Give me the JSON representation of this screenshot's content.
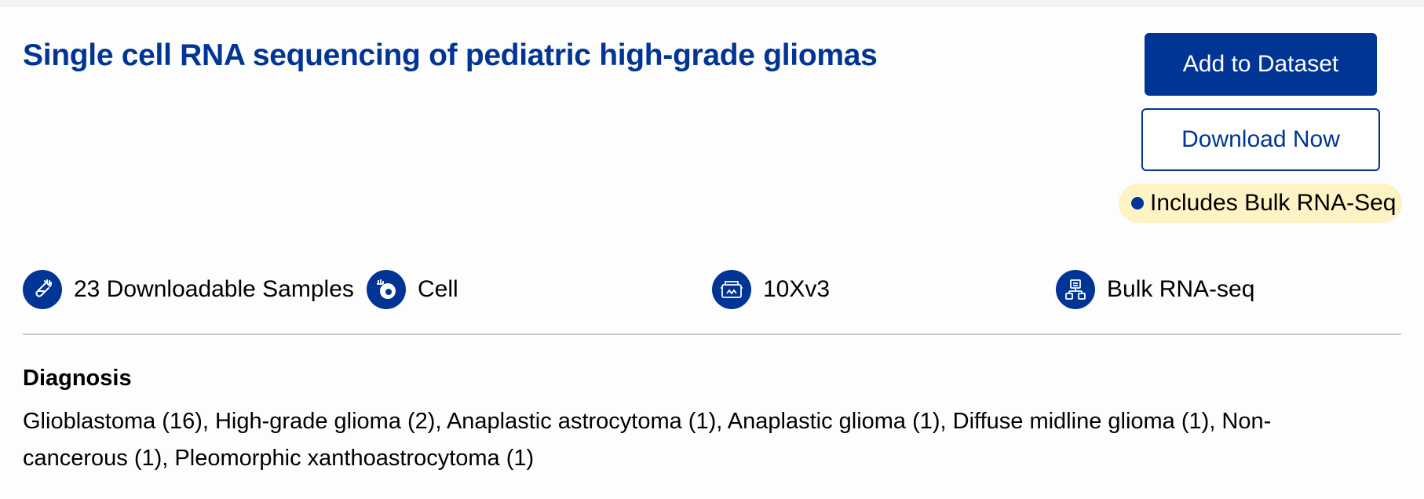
{
  "project": {
    "title": "Single cell RNA sequencing of pediatric high-grade gliomas"
  },
  "actions": {
    "add_to_dataset_label": "Add to Dataset",
    "download_now_label": "Download Now"
  },
  "badge": {
    "label": "Includes Bulk RNA-Seq",
    "color": "#fdf3c4",
    "dot_color": "#003596"
  },
  "meta": {
    "samples": {
      "icon": "test-tube-icon",
      "label": "23 Downloadable Samples"
    },
    "suspension": {
      "icon": "cell-icon",
      "label": "Cell"
    },
    "technology": {
      "icon": "sequencer-icon",
      "label": "10Xv3"
    },
    "modality": {
      "icon": "bulk-rna-seq-icon",
      "label": "Bulk RNA-seq"
    }
  },
  "diagnosis": {
    "heading": "Diagnosis",
    "values": "Glioblastoma (16), High-grade glioma (2), Anaplastic astrocytoma (1), Anaplastic glioma (1), Diffuse midline glioma (1), Non-cancerous (1), Pleomorphic xanthoastrocytoma (1)"
  },
  "colors": {
    "brand": "#003596",
    "divider": "#cccccc",
    "background": "#fdfdfd"
  }
}
